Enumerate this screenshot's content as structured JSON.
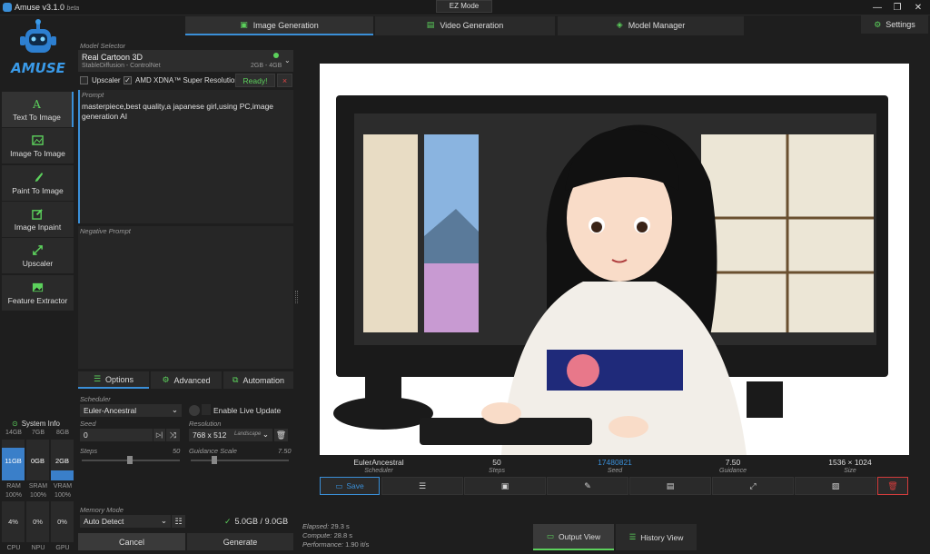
{
  "app": {
    "title": "Amuse v3.1.0",
    "badge": "beta",
    "ez_mode": "EZ Mode",
    "logo_text": "AMUSE"
  },
  "top_tabs": [
    {
      "label": "Image Generation"
    },
    {
      "label": "Video Generation"
    },
    {
      "label": "Model Manager"
    }
  ],
  "settings_label": "Settings",
  "sidebar": [
    {
      "label": "Text To Image"
    },
    {
      "label": "Image To Image"
    },
    {
      "label": "Paint To Image"
    },
    {
      "label": "Image Inpaint"
    },
    {
      "label": "Upscaler"
    },
    {
      "label": "Feature Extractor"
    }
  ],
  "model": {
    "section": "Model Selector",
    "name": "Real Cartoon 3D",
    "sub": "StableDiffusion - ControlNet",
    "mem": "2GB - 4GB",
    "upscaler": "Upscaler",
    "xdna": "AMD XDNA™ Super Resolution",
    "ready": "Ready!",
    "close": "×"
  },
  "prompt": {
    "label": "Prompt",
    "text": "masterpiece,best quality,a japanese girl,using PC,image generation AI",
    "neg_label": "Negative Prompt"
  },
  "option_tabs": [
    {
      "label": "Options"
    },
    {
      "label": "Advanced"
    },
    {
      "label": "Automation"
    }
  ],
  "options": {
    "scheduler_label": "Scheduler",
    "scheduler": "Euler-Ancestral",
    "live_update": "Enable Live Update",
    "seed_label": "Seed",
    "seed": "0",
    "resolution_label": "Resolution",
    "resolution": "768 x 512",
    "orientation": "Landscape",
    "steps_label": "Steps",
    "steps_max": "50",
    "guidance_label": "Guidance Scale",
    "guidance_val": "7.50"
  },
  "sysinfo": {
    "title": "System Info",
    "caps": [
      "14GB",
      "7GB",
      "8GB"
    ],
    "vals": [
      "11GB",
      "0GB",
      "2GB"
    ],
    "names": [
      "RAM",
      "SRAM",
      "VRAM"
    ],
    "pcts": [
      "100%",
      "100%",
      "100%"
    ],
    "util": [
      "4%",
      "0%",
      "0%"
    ],
    "units": [
      "CPU",
      "NPU",
      "GPU"
    ],
    "fill": [
      0.79,
      0,
      0.25
    ]
  },
  "memory": {
    "label": "Memory Mode",
    "value": "Auto Detect",
    "usage": "5.0GB / 9.0GB"
  },
  "actions": {
    "cancel": "Cancel",
    "generate": "Generate"
  },
  "result": {
    "scheduler": "EulerAncestral",
    "scheduler_l": "Scheduler",
    "steps": "50",
    "steps_l": "Steps",
    "seed": "17480821",
    "seed_l": "Seed",
    "guidance": "7.50",
    "guidance_l": "Guidance",
    "size": "1536 × 1024",
    "size_l": "Size",
    "save": "Save"
  },
  "stats": {
    "elapsed_l": "Elapsed:",
    "elapsed": "29.3 s",
    "compute_l": "Compute:",
    "compute": "28.8 s",
    "perf_l": "Performance:",
    "perf": "1.90 it/s"
  },
  "views": {
    "output": "Output View",
    "history": "History View"
  },
  "colors": {
    "accent": "#3a8fd8",
    "green": "#5cd15c",
    "danger": "#d23c3c"
  }
}
